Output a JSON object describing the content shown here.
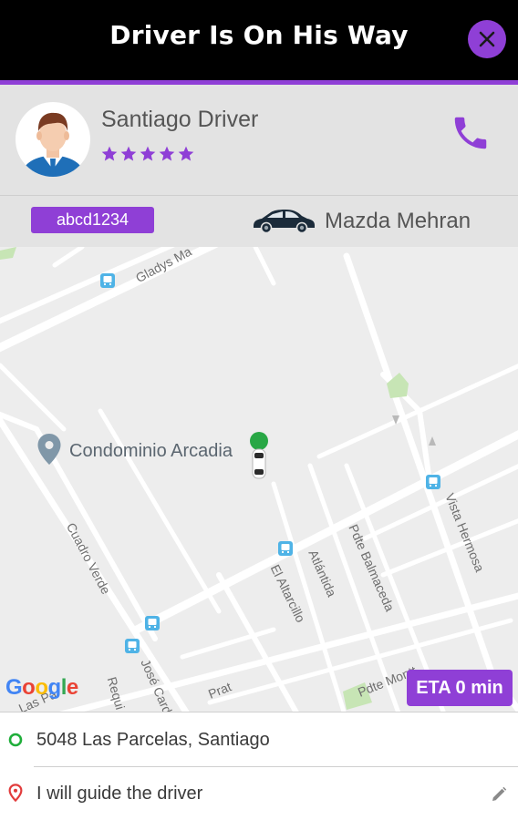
{
  "header": {
    "title": "Driver Is On His Way",
    "close_icon": "close-icon"
  },
  "colors": {
    "accent": "#8f3fd6",
    "header_bg": "#000000",
    "panel_bg": "#e3e3e3",
    "pickup_green": "#1fae3a",
    "dropoff_red": "#e23b3b",
    "marker_green": "#28a745"
  },
  "driver": {
    "name": "Santiago Driver",
    "rating": 5,
    "max_rating": 5,
    "avatar_icon": "driver-avatar",
    "call_icon": "phone-icon"
  },
  "vehicle": {
    "plate": "abcd1234",
    "model": "Mazda Mehran",
    "icon": "car-icon"
  },
  "map": {
    "poi_name": "Condominio Arcadia",
    "street_labels": {
      "gladys": "Gladys Ma",
      "cuadro_verde": "Cuadro Verde",
      "el_altarcillo": "El Altarcillo",
      "atlantida": "Atlántida",
      "pdte_balmaceda": "Pdte Balmaceda",
      "vista_hermosa": "Vista Hermosa",
      "pdte_montt": "Pdte Montt",
      "jose_card": "José Card",
      "prat": "Prat",
      "requi": "Requi",
      "las_pa": "Las Pa"
    },
    "attribution": [
      "G",
      "o",
      "o",
      "g",
      "l",
      "e"
    ],
    "eta_label": "ETA 0 min"
  },
  "addresses": {
    "pickup": "5048 Las Parcelas, Santiago",
    "dropoff": "I will guide the driver",
    "pickup_icon": "pickup-circle-icon",
    "dropoff_icon": "location-pin-icon",
    "edit_icon": "pencil-icon"
  }
}
